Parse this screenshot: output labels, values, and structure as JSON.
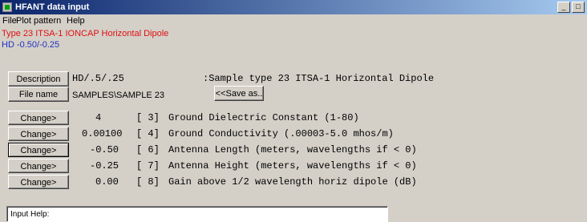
{
  "window": {
    "title": "HFANT data input",
    "controls": [
      "_",
      "□"
    ]
  },
  "menu": [
    {
      "label": "File"
    },
    {
      "label": "Plot pattern"
    },
    {
      "label": "Help"
    }
  ],
  "info": {
    "line1": "Type 23 ITSA-1 IONCAP  Horizontal Dipole",
    "line2": "HD -0.50/-0.25"
  },
  "description": {
    "button": "Description",
    "value": "HD/.5/.25",
    "comment": ":Sample type 23 ITSA-1 Horizontal Dipole"
  },
  "file": {
    "button": "File name",
    "value": "SAMPLES\\SAMPLE 23",
    "save_button": "<<Save as.."
  },
  "params": [
    {
      "button": "Change>",
      "value": "4",
      "index": "[ 3]",
      "label": "Ground Dielectric Constant (1-80)"
    },
    {
      "button": "Change>",
      "value": "0.00100",
      "index": "[ 4]",
      "label": "Ground Conductivity (.00003-5.0 mhos/m)"
    },
    {
      "button": "Change>",
      "value": "-0.50",
      "index": "[ 6]",
      "label": "Antenna Length (meters, wavelengths if < 0)"
    },
    {
      "button": "Change>",
      "value": "-0.25",
      "index": "[ 7]",
      "label": "Antenna Height (meters, wavelengths if < 0)"
    },
    {
      "button": "Change>",
      "value": "0.00",
      "index": "[ 8]",
      "label": "Gain above 1/2 wavelength horiz dipole (dB)"
    }
  ],
  "help": {
    "label": "Input Help:"
  },
  "colors": {
    "title_gradient_start": "#0a246a",
    "info_red": "#e01010",
    "info_blue": "#2030c0",
    "window_bg": "#d4d0c8"
  }
}
